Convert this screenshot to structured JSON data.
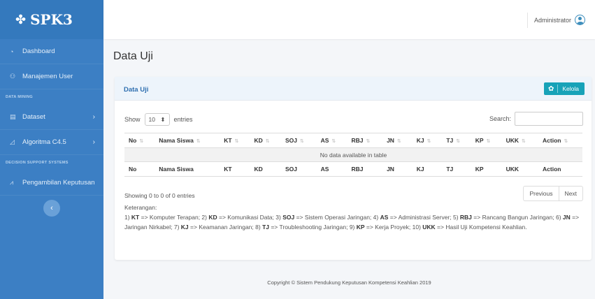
{
  "brand": {
    "name": "SPK3",
    "icon": "cubes-icon"
  },
  "sidebar": {
    "items": [
      {
        "label": "Dashboard",
        "icon": "dashboard-icon"
      },
      {
        "label": "Manajemen User",
        "icon": "users-icon"
      }
    ],
    "section1": "DATA MINING",
    "mining": [
      {
        "label": "Dataset",
        "icon": "table-icon",
        "chevron": "›"
      },
      {
        "label": "Algoritma C4.5",
        "icon": "area-chart-icon",
        "chevron": "›"
      }
    ],
    "section2": "DECISION SUPPORT SYSTEMS",
    "dss": [
      {
        "label": "Pengambilan Keputusan",
        "icon": "line-chart-icon"
      }
    ],
    "collapse": "‹"
  },
  "topbar": {
    "user": "Administrator"
  },
  "page": {
    "title": "Data Uji"
  },
  "box": {
    "title": "Data Uji",
    "button": "Kelola"
  },
  "table_controls": {
    "show": "Show",
    "length": "10",
    "entries": "entries",
    "search": "Search:"
  },
  "table": {
    "columns": [
      "No",
      "Nama Siswa",
      "KT",
      "KD",
      "SOJ",
      "AS",
      "RBJ",
      "JN",
      "KJ",
      "TJ",
      "KP",
      "UKK",
      "Action"
    ],
    "empty": "No data available in table"
  },
  "info": "Showing 0 to 0 of 0 entries",
  "pager": {
    "prev": "Previous",
    "next": "Next"
  },
  "notes": {
    "label": "Keterangan:",
    "items": [
      {
        "pre": "1) ",
        "abbr": "KT",
        "desc": " => Komputer Terapan; "
      },
      {
        "pre": "2) ",
        "abbr": "KD",
        "desc": " => Komunikasi Data; "
      },
      {
        "pre": "3) ",
        "abbr": "SOJ",
        "desc": " => Sistem Operasi Jaringan; "
      },
      {
        "pre": "4) ",
        "abbr": "AS",
        "desc": " => Administrasi Server; "
      },
      {
        "pre": "5) ",
        "abbr": "RBJ",
        "desc": " => Rancang Bangun Jaringan; "
      },
      {
        "pre": "6) ",
        "abbr": "JN",
        "desc": " => Jaringan Nirkabel; "
      },
      {
        "pre": "7) ",
        "abbr": "KJ",
        "desc": " => Keamanan Jaringan; "
      },
      {
        "pre": "8) ",
        "abbr": "TJ",
        "desc": " => Troubleshooting Jaringan; "
      },
      {
        "pre": "9) ",
        "abbr": "KP",
        "desc": " => Kerja Proyek; "
      },
      {
        "pre": "10) ",
        "abbr": "UKK",
        "desc": " => Hasil Uji Kompetensi Keahlian."
      }
    ]
  },
  "footer": "Copyright © Sistem Pendukung Keputusan Kompetensi Keahlian 2019"
}
